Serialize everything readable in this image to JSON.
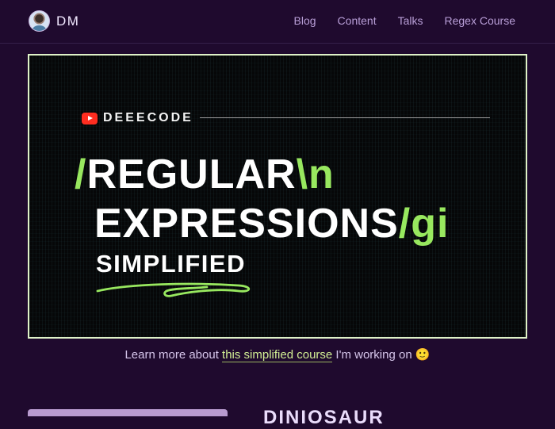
{
  "header": {
    "brand": "DM",
    "nav": [
      "Blog",
      "Content",
      "Talks",
      "Regex Course"
    ]
  },
  "hero": {
    "channel": "DEEECODE",
    "title_line1_prefix": "/",
    "title_line1_word": "REGULAR",
    "title_line1_suffix": "\\n",
    "title_line2_word": "EXPRESSIONS",
    "title_line2_suffix": "/gi",
    "subtitle": "SIMPLIFIED"
  },
  "caption": {
    "prefix": "Learn more about ",
    "link": "this simplified course",
    "suffix": " I'm working on 🙂"
  },
  "next_section": {
    "heading": "DINIOSAUR"
  },
  "colors": {
    "background": "#1f0a2e",
    "accent_green": "#98e85f",
    "nav_text": "#b99fd8"
  },
  "icons": [
    "youtube-icon",
    "squiggle-underline"
  ]
}
